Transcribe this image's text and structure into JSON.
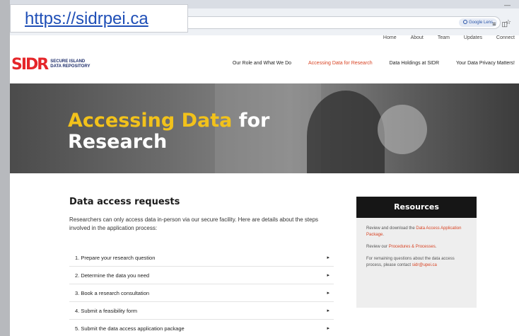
{
  "callout_url": "https://sidrpei.ca",
  "browser": {
    "lens_label": "Google Lens"
  },
  "topnav": [
    "Home",
    "About",
    "Team",
    "Updates",
    "Connect"
  ],
  "logo": {
    "mark": "SIDR",
    "line1": "SECURE ISLAND",
    "line2": "DATA REPOSITORY"
  },
  "mainnav": [
    {
      "label": "Our Role and What We Do",
      "active": false
    },
    {
      "label": "Accessing Data for Research",
      "active": true
    },
    {
      "label": "Data Holdings at SIDR",
      "active": false
    },
    {
      "label": "Your Data Privacy Matters!",
      "active": false
    }
  ],
  "hero": {
    "title_highlight": "Accessing Data",
    "title_rest_1": " for",
    "title_line2": "Research"
  },
  "content": {
    "title": "Data access requests",
    "intro": "Researchers can only access data in-person via our secure facility. Here are details about the steps involved in the application process:",
    "steps": [
      "1. Prepare your research question",
      "2. Determine the data you need",
      "3. Book a research consultation",
      "4. Submit a feasibility form",
      "5. Submit the data access application package"
    ]
  },
  "resources": {
    "title": "Resources",
    "item1_prefix": "Review and download the ",
    "item1_link": "Data Access Application Package",
    "item1_suffix": ".",
    "item2_prefix": "Review our ",
    "item2_link": "Procedures & Processes",
    "item2_suffix": ".",
    "item3_prefix": "For remaining questions about the data access process, please contact ",
    "item3_link": "sidr@upei.ca"
  },
  "colors": {
    "accent": "#d84323",
    "highlight": "#f2c21b",
    "logo_red": "#e5262a",
    "logo_navy": "#1d2d6b"
  }
}
